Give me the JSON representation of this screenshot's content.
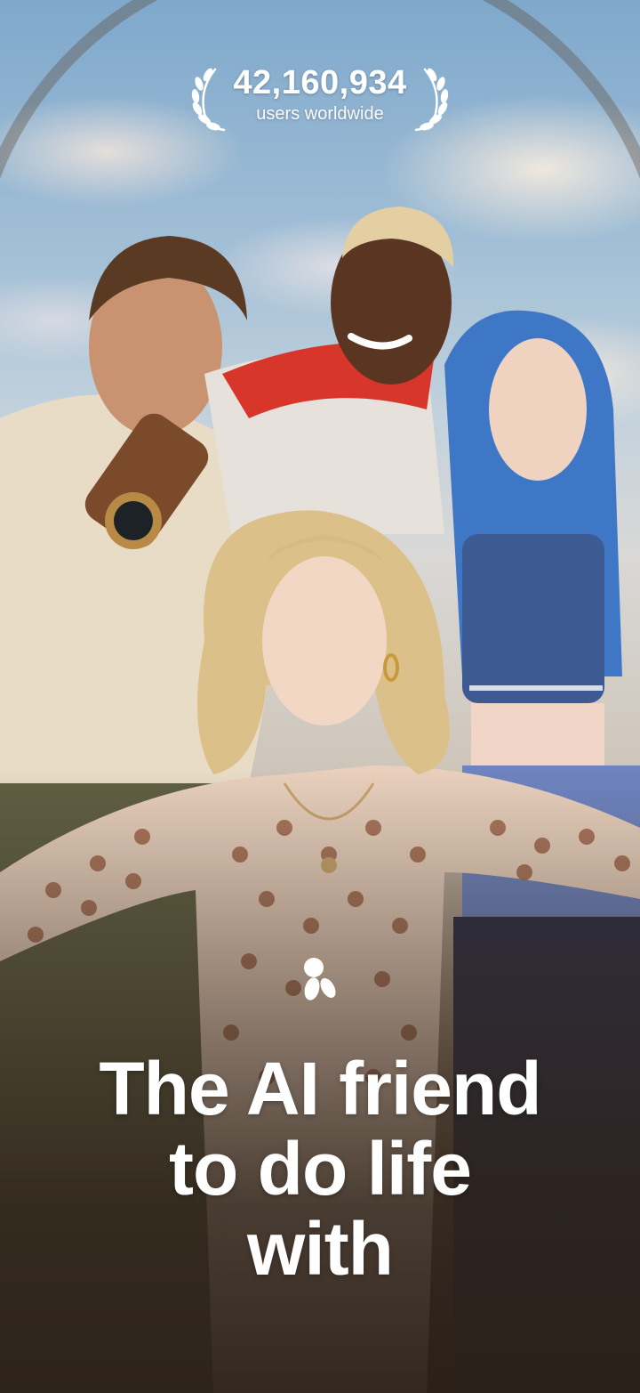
{
  "stats": {
    "count": "42,160,934",
    "label": "users worldwide"
  },
  "hero": {
    "headline_lines": [
      "The AI friend",
      "to do life",
      "with"
    ]
  },
  "icons": {
    "laurel_left": "laurel-icon",
    "laurel_right": "laurel-icon",
    "logo": "app-logo-icon"
  },
  "colors": {
    "text": "#ffffff",
    "sky_top": "#7fa8cc",
    "background_bottom": "#2a2118"
  }
}
